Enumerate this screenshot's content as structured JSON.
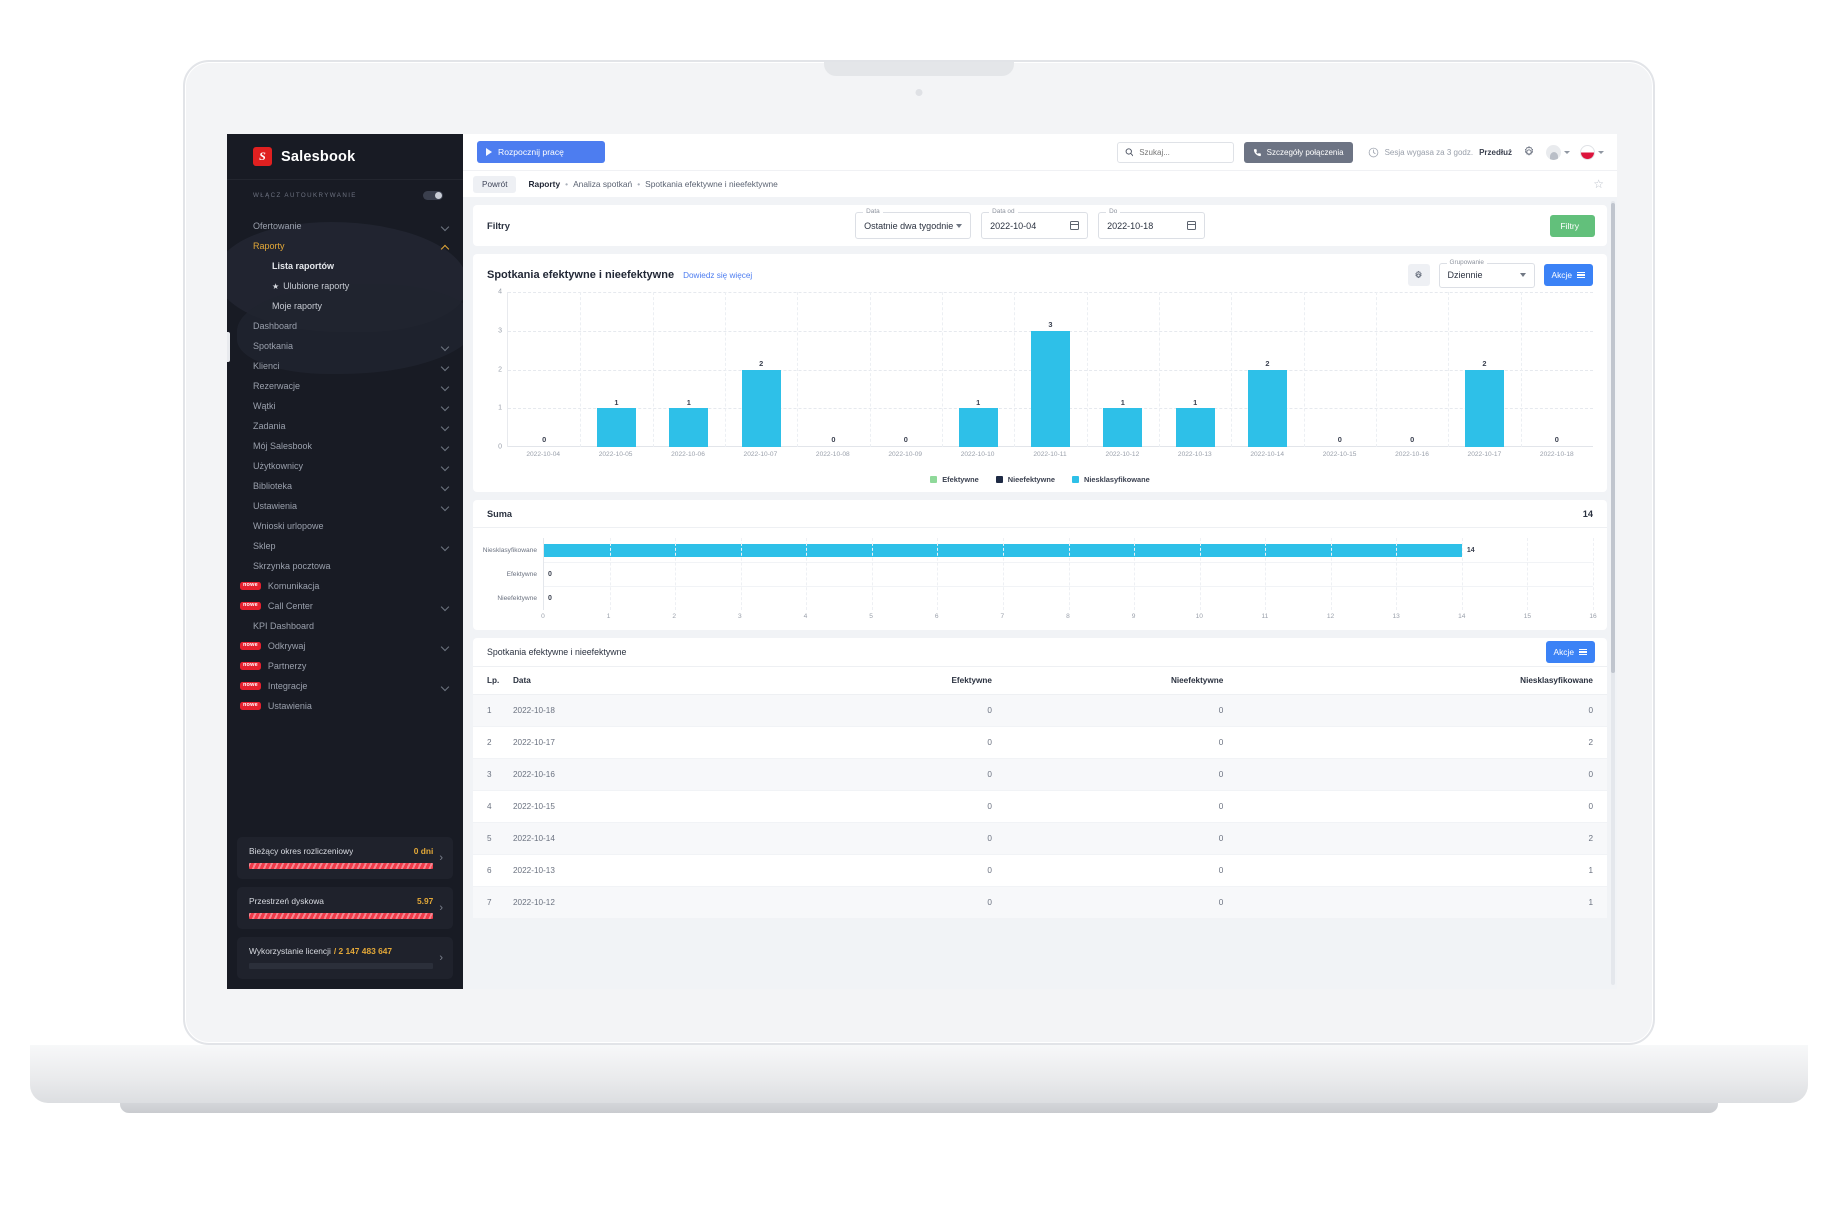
{
  "sidebar": {
    "brand": "Salesbook",
    "brand_mark": "S",
    "autohide_label": "WŁĄCZ AUTOUKRYWANIE",
    "items": [
      {
        "label": "Ofertowanie",
        "chevron": true
      },
      {
        "label": "Raporty",
        "chevron": true,
        "active": true
      },
      {
        "label": "Lista raportów",
        "sub": true,
        "bold": true
      },
      {
        "label": "Ulubione raporty",
        "sub": true,
        "star": true
      },
      {
        "label": "Moje raporty",
        "sub": true
      },
      {
        "label": "Dashboard"
      },
      {
        "label": "Spotkania",
        "chevron": true
      },
      {
        "label": "Klienci",
        "chevron": true
      },
      {
        "label": "Rezerwacje",
        "chevron": true
      },
      {
        "label": "Wątki",
        "chevron": true
      },
      {
        "label": "Zadania",
        "chevron": true
      },
      {
        "label": "Mój Salesbook",
        "chevron": true
      },
      {
        "label": "Użytkownicy",
        "chevron": true
      },
      {
        "label": "Biblioteka",
        "chevron": true
      },
      {
        "label": "Ustawienia",
        "chevron": true
      },
      {
        "label": "Wnioski urlopowe"
      },
      {
        "label": "Sklep",
        "chevron": true
      },
      {
        "label": "Skrzynka pocztowa"
      },
      {
        "label": "Komunikacja",
        "badge": "nowe"
      },
      {
        "label": "Call Center",
        "badge": "nowe",
        "chevron": true
      },
      {
        "label": "KPI Dashboard"
      },
      {
        "label": "Odkrywaj",
        "badge": "nowe",
        "chevron": true
      },
      {
        "label": "Partnerzy",
        "badge": "nowe"
      },
      {
        "label": "Integracje",
        "badge": "nowe",
        "chevron": true
      },
      {
        "label": "Ustawienia",
        "badge": "nowe"
      }
    ],
    "cards": [
      {
        "title": "Bieżący okres rozliczeniowy",
        "value": "0 dni",
        "fill": 100,
        "style": "hatch",
        "arrow": "›"
      },
      {
        "title": "Przestrzeń dyskowa",
        "value": "5.97",
        "fill": 100,
        "style": "hatch",
        "arrow": "›"
      },
      {
        "title": "Wykorzystanie licencji",
        "value": "/ 2 147 483 647",
        "fill": 100,
        "style": "dark",
        "arrow": "›"
      }
    ]
  },
  "topbar": {
    "start_work": "Rozpocznij pracę",
    "search_placeholder": "Szukaj...",
    "connection_details": "Szczegóły połączenia",
    "session_text": "Sesja wygasa za 3 godz.",
    "extend": "Przedłuż"
  },
  "breadcrumb": {
    "back": "Powrót",
    "root": "Raporty",
    "sep": "•",
    "level2": "Analiza spotkań",
    "level3": "Spotkania efektywne i nieefektywne",
    "star": "☆"
  },
  "filters": {
    "label": "Filtry",
    "data_label": "Data",
    "data_value": "Ostatnie dwa tygodnie",
    "from_label": "Data od",
    "from_value": "2022-10-04",
    "to_label": "Do",
    "to_value": "2022-10-18",
    "button": "Filtry"
  },
  "chart_panel": {
    "title": "Spotkania efektywne i nieefektywne",
    "learn_more": "Dowiedz się więcej",
    "group_label": "Grupowanie",
    "group_value": "Dziennie",
    "actions": "Akcje"
  },
  "suma": {
    "title": "Suma",
    "total": "14"
  },
  "table_panel": {
    "title": "Spotkania efektywne i nieefektywne",
    "actions": "Akcje",
    "columns": [
      "Lp.",
      "Data",
      "Efektywne",
      "Nieefektywne",
      "Niesklasyfikowane"
    ],
    "rows": [
      [
        "1",
        "2022-10-18",
        "0",
        "0",
        "0"
      ],
      [
        "2",
        "2022-10-17",
        "0",
        "0",
        "2"
      ],
      [
        "3",
        "2022-10-16",
        "0",
        "0",
        "0"
      ],
      [
        "4",
        "2022-10-15",
        "0",
        "0",
        "0"
      ],
      [
        "5",
        "2022-10-14",
        "0",
        "0",
        "2"
      ],
      [
        "6",
        "2022-10-13",
        "0",
        "0",
        "1"
      ],
      [
        "7",
        "2022-10-12",
        "0",
        "0",
        "1"
      ]
    ]
  },
  "colors": {
    "efektywne": "#8fd99a",
    "nieefektywne": "#1e2a44",
    "niesklasyfikowane": "#2ec0e8",
    "accent_blue": "#3b82f6",
    "accent_green": "#62c07b",
    "brand_red": "#e02020",
    "sidebar_bg": "#181b24"
  },
  "chart_data": {
    "type": "bar",
    "title": "Spotkania efektywne i nieefektywne",
    "xlabel": "",
    "ylabel": "",
    "ylim": [
      0,
      4
    ],
    "yticks": [
      0,
      1,
      2,
      3,
      4
    ],
    "grid": true,
    "legend_position": "bottom",
    "categories": [
      "2022-10-04",
      "2022-10-05",
      "2022-10-06",
      "2022-10-07",
      "2022-10-08",
      "2022-10-09",
      "2022-10-10",
      "2022-10-11",
      "2022-10-12",
      "2022-10-13",
      "2022-10-14",
      "2022-10-15",
      "2022-10-16",
      "2022-10-17",
      "2022-10-18"
    ],
    "series": [
      {
        "name": "Efektywne",
        "color": "#8fd99a",
        "values": [
          0,
          0,
          0,
          0,
          0,
          0,
          0,
          0,
          0,
          0,
          0,
          0,
          0,
          0,
          0
        ]
      },
      {
        "name": "Nieefektywne",
        "color": "#1e2a44",
        "values": [
          0,
          0,
          0,
          0,
          0,
          0,
          0,
          0,
          0,
          0,
          0,
          0,
          0,
          0,
          0
        ]
      },
      {
        "name": "Niesklasyfikowane",
        "color": "#2ec0e8",
        "values": [
          0,
          1,
          1,
          2,
          0,
          0,
          1,
          3,
          1,
          1,
          2,
          0,
          0,
          2,
          0
        ]
      }
    ],
    "data_labels": [
      "0",
      "1",
      "1",
      "2",
      "0",
      "0",
      "1",
      "3",
      "1",
      "1",
      "2",
      "0",
      "0",
      "2",
      "0"
    ]
  },
  "chart_data_2": {
    "type": "bar",
    "orientation": "horizontal",
    "title": "Suma",
    "total": 14,
    "categories": [
      "Niesklasyfikowane",
      "Efektywne",
      "Nieefektywne"
    ],
    "values": [
      14,
      0,
      0
    ],
    "color": "#2ec0e8",
    "xlim": [
      0,
      16
    ],
    "xticks": [
      0,
      1,
      2,
      3,
      4,
      5,
      6,
      7,
      8,
      9,
      10,
      11,
      12,
      13,
      14,
      15,
      16
    ],
    "grid": true
  }
}
